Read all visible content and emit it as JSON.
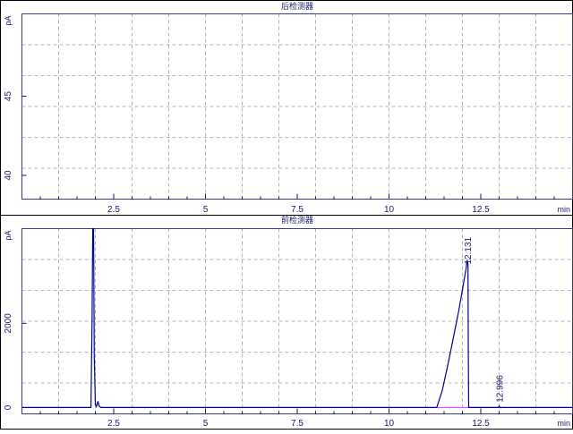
{
  "chart_data": [
    {
      "type": "line",
      "title": "后检测器",
      "xlabel": "min",
      "ylabel": "pA",
      "xlim": [
        0,
        15
      ],
      "ylim": [
        38.5,
        50.2
      ],
      "x_ticks": [
        {
          "value": 2.5,
          "label": "2.5"
        },
        {
          "value": 5,
          "label": "5"
        },
        {
          "value": 7.5,
          "label": "7.5"
        },
        {
          "value": 10,
          "label": "10"
        },
        {
          "value": 12.5,
          "label": "12.5"
        }
      ],
      "y_ticks": [
        {
          "value": 40,
          "label": "40"
        },
        {
          "value": 45,
          "label": "45"
        }
      ],
      "grid": true,
      "series": [
        {
          "points": []
        }
      ]
    },
    {
      "type": "line",
      "title": "前检测器",
      "xlabel": "min",
      "ylabel": "pA",
      "xlim": [
        0,
        15
      ],
      "ylim": [
        -150,
        4250
      ],
      "x_ticks": [
        {
          "value": 2.5,
          "label": "2.5"
        },
        {
          "value": 5,
          "label": "5"
        },
        {
          "value": 7.5,
          "label": "7.5"
        },
        {
          "value": 10,
          "label": "10"
        },
        {
          "value": 12.5,
          "label": "12.5"
        }
      ],
      "y_ticks": [
        {
          "value": 0,
          "label": "0"
        },
        {
          "value": 2000,
          "label": "2000"
        }
      ],
      "grid": true,
      "series": [
        {
          "points": [
            [
              0,
              0
            ],
            [
              1.88,
              0
            ],
            [
              1.91,
              2000
            ],
            [
              1.93,
              4250
            ],
            [
              1.95,
              4250
            ],
            [
              1.97,
              1200
            ],
            [
              2.0,
              80
            ],
            [
              2.03,
              20
            ],
            [
              2.07,
              150
            ],
            [
              2.1,
              40
            ],
            [
              2.15,
              0
            ],
            [
              11.3,
              0
            ],
            [
              11.45,
              400
            ],
            [
              11.6,
              1000
            ],
            [
              11.75,
              1650
            ],
            [
              11.9,
              2300
            ],
            [
              12.0,
              2800
            ],
            [
              12.1,
              3300
            ],
            [
              12.13,
              3500
            ],
            [
              12.15,
              3400
            ],
            [
              12.16,
              1200
            ],
            [
              12.17,
              0
            ],
            [
              12.98,
              0
            ],
            [
              13.0,
              35
            ],
            [
              13.02,
              0
            ],
            [
              15,
              0
            ]
          ]
        }
      ],
      "baselines": [
        {
          "x1": 11.3,
          "x2": 12.95,
          "y": 0
        }
      ],
      "peak_labels": [
        {
          "x": 12.131,
          "y": 3500,
          "label": "12.131"
        },
        {
          "x": 12.996,
          "y": 35,
          "label": "12.996"
        }
      ]
    }
  ]
}
